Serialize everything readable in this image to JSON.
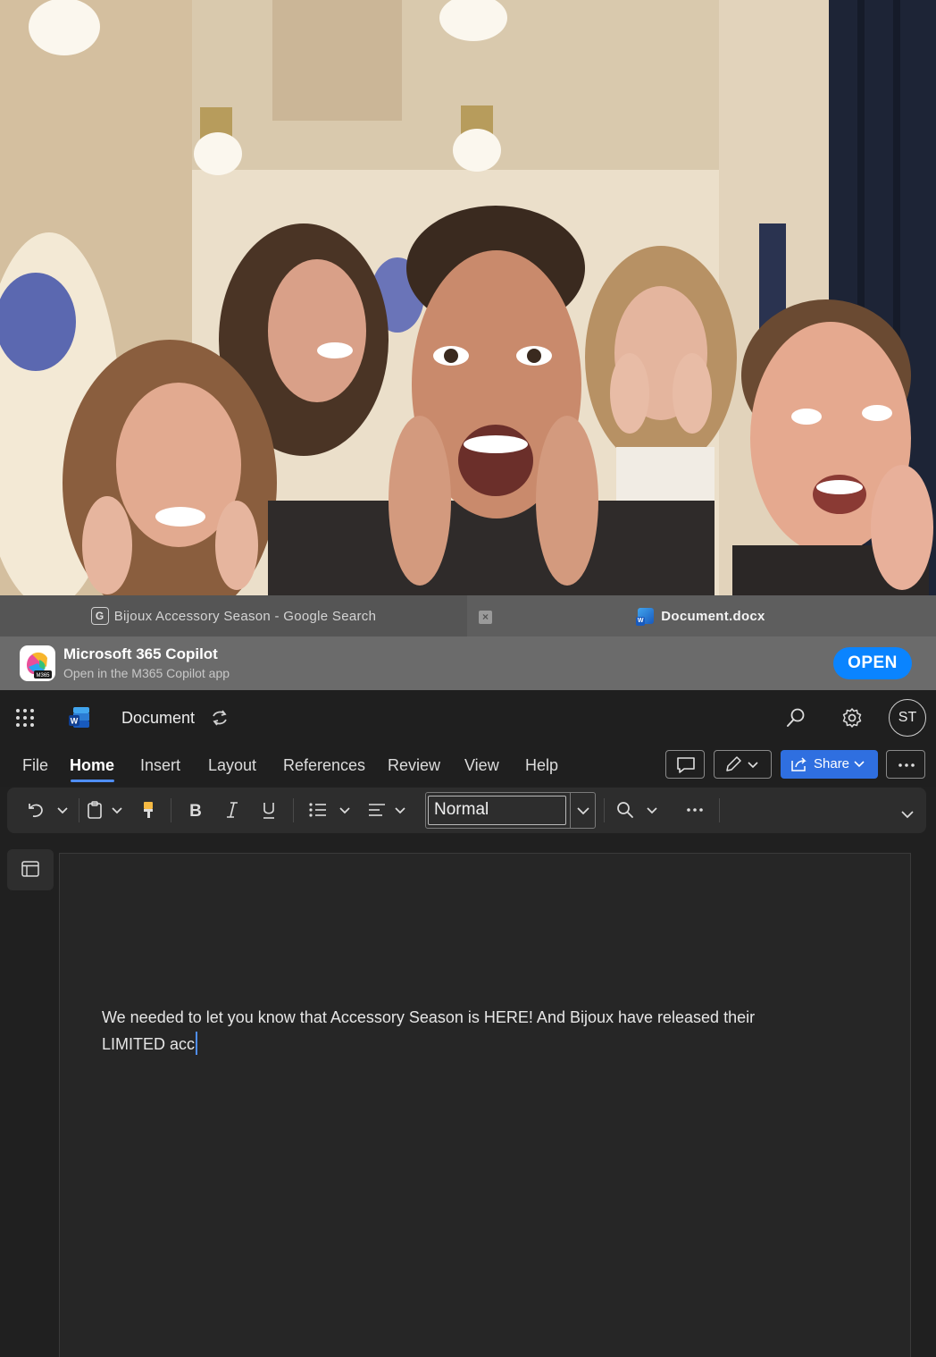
{
  "browser": {
    "tabs": [
      {
        "label": "Bijoux Accessory Season - Google Search",
        "icon": "google-icon"
      },
      {
        "label": "Document.docx",
        "icon": "word-icon"
      }
    ],
    "close_glyph": "×"
  },
  "banner": {
    "title": "Microsoft 365 Copilot",
    "subtitle": "Open in the M365 Copilot app",
    "open_label": "OPEN"
  },
  "titlebar": {
    "doc_title": "Document",
    "avatar_initials": "ST"
  },
  "ribbon_tabs": [
    "File",
    "Home",
    "Insert",
    "Layout",
    "References",
    "Review",
    "View",
    "Help"
  ],
  "share_label": "Share",
  "style_value": "Normal",
  "document": {
    "text": "We needed to let you know that Accessory Season is HERE! And Bijoux have released their LIMITED acc"
  },
  "colors": {
    "accent": "#4f8ef7",
    "share": "#2f6fe0",
    "open_button": "#0a84ff"
  }
}
